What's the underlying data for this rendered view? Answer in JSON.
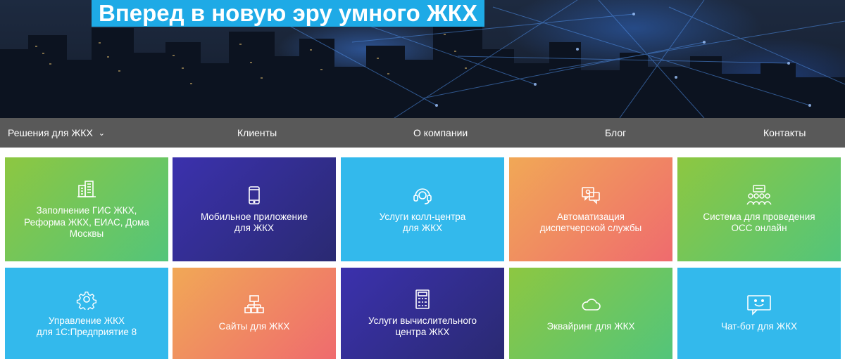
{
  "hero": {
    "title": "Вперед в новую эру умного ЖКХ"
  },
  "nav": {
    "items": [
      {
        "label": "Решения для ЖКХ",
        "has_dropdown": true
      },
      {
        "label": "Клиенты"
      },
      {
        "label": "О компании"
      },
      {
        "label": "Блог"
      },
      {
        "label": "Контакты"
      }
    ]
  },
  "tiles": [
    {
      "icon": "buildings-icon",
      "lines": [
        "Заполнение ГИС ЖКХ,",
        "Реформа ЖКХ, ЕИАС, Дома",
        "Москвы"
      ]
    },
    {
      "icon": "mobile-phone-icon",
      "lines": [
        "Мобильное приложение",
        "для ЖКХ"
      ]
    },
    {
      "icon": "headset-icon",
      "lines": [
        "Услуги колл-центра",
        "для ЖКХ"
      ]
    },
    {
      "icon": "dispatch-chat-icon",
      "lines": [
        "Автоматизация",
        "диспетчерской службы"
      ]
    },
    {
      "icon": "meeting-people-icon",
      "lines": [
        "Система для проведения",
        "ОСС онлайн"
      ]
    },
    {
      "icon": "gear-icon",
      "lines": [
        "Управление ЖКХ",
        "для 1С:Предприятие 8"
      ]
    },
    {
      "icon": "sitemap-icon",
      "lines": [
        "Сайты для ЖКХ"
      ]
    },
    {
      "icon": "calculator-icon",
      "lines": [
        "Услуги вычислительного",
        "центра ЖКХ"
      ]
    },
    {
      "icon": "cloud-icon",
      "lines": [
        "Эквайринг для ЖКХ"
      ]
    },
    {
      "icon": "chat-bot-icon",
      "lines": [
        "Чат-бот для ЖКХ"
      ]
    }
  ]
}
